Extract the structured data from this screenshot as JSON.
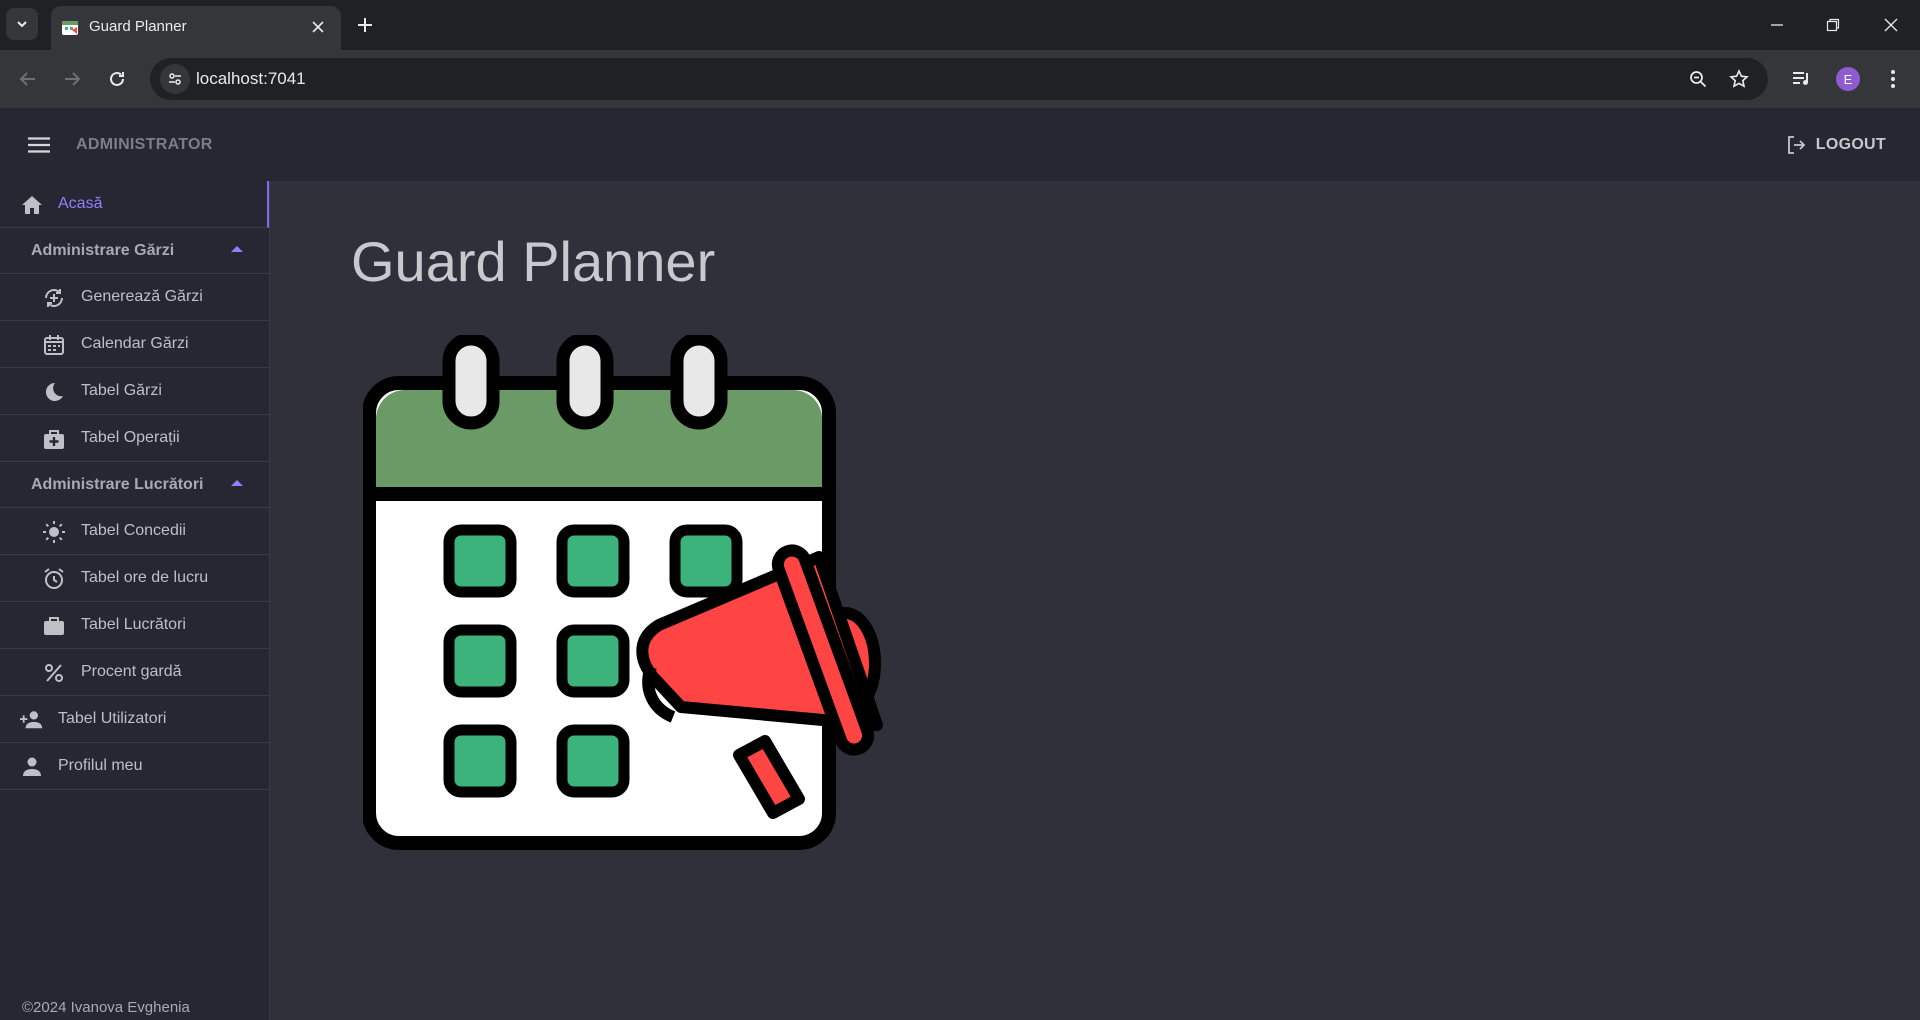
{
  "browser": {
    "tab_title": "Guard Planner",
    "url": "localhost:7041",
    "profile_initial": "E"
  },
  "appbar": {
    "role": "ADMINISTRATOR",
    "logout_label": "LOGOUT"
  },
  "sidebar": {
    "home": {
      "label": "Acasă",
      "icon": "home-icon"
    },
    "groups": [
      {
        "label": "Administrare Gărzi",
        "items": [
          {
            "label": "Generează Gărzi",
            "icon": "generate-icon"
          },
          {
            "label": "Calendar Gărzi",
            "icon": "calendar-icon"
          },
          {
            "label": "Tabel Gărzi",
            "icon": "moon-icon"
          },
          {
            "label": "Tabel Operații",
            "icon": "medkit-icon"
          }
        ]
      },
      {
        "label": "Administrare Lucrători",
        "items": [
          {
            "label": "Tabel Concedii",
            "icon": "sun-icon"
          },
          {
            "label": "Tabel ore de lucru",
            "icon": "alarm-icon"
          },
          {
            "label": "Tabel Lucrători",
            "icon": "briefcase-icon"
          },
          {
            "label": "Procent gardă",
            "icon": "percent-icon"
          }
        ]
      }
    ],
    "users": {
      "label": "Tabel Utilizatori",
      "icon": "add-user-icon"
    },
    "profile": {
      "label": "Profilul meu",
      "icon": "person-icon"
    },
    "footer": "©2024 Ivanova Evghenia"
  },
  "main": {
    "title": "Guard Planner",
    "illustration": "calendar-megaphone-illustration"
  },
  "colors": {
    "accent": "#8f80ff",
    "calendar_header": "#6a9a66",
    "calendar_cell": "#3bb37a",
    "megaphone": "#ff4444"
  }
}
